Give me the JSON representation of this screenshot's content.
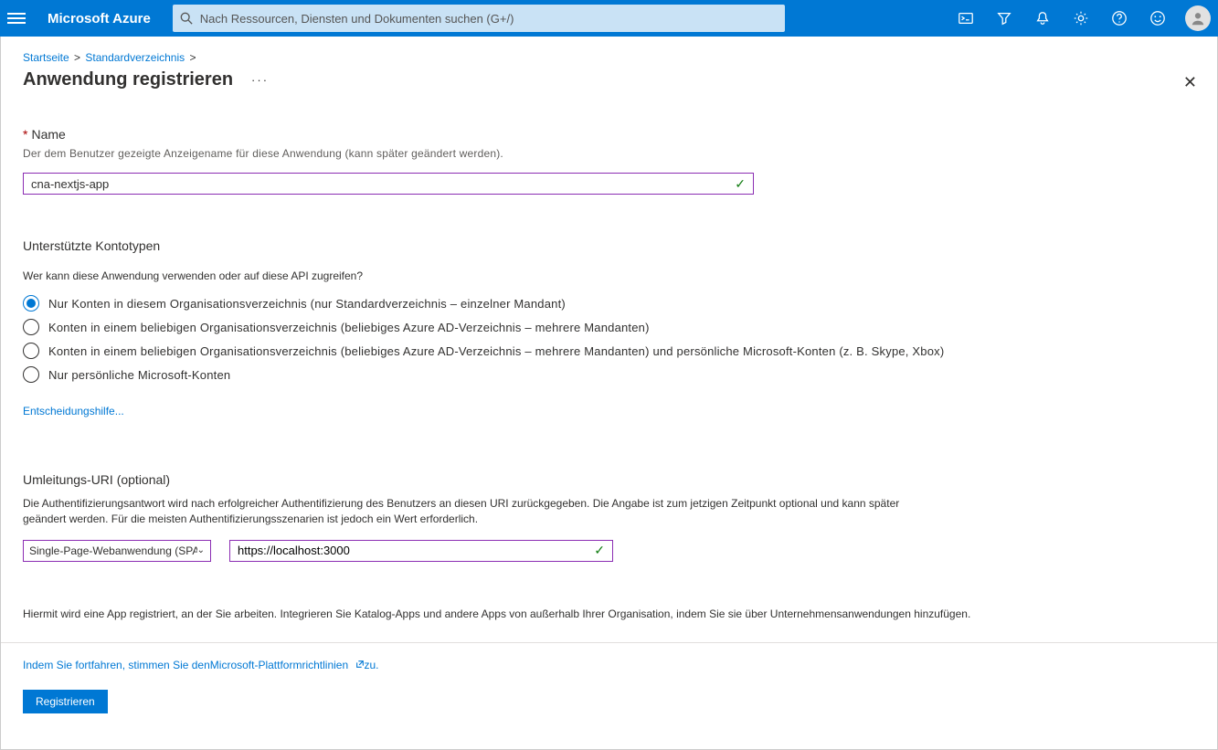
{
  "header": {
    "brand": "Microsoft Azure",
    "search_placeholder": "Nach Ressourcen, Diensten und Dokumenten suchen (G+/)"
  },
  "breadcrumb": {
    "home": "Startseite",
    "dir": "Standardverzeichnis"
  },
  "page": {
    "title": "Anwendung registrieren"
  },
  "name_section": {
    "label": "Name",
    "helper": "Der dem Benutzer gezeigte Anzeigename für diese Anwendung (kann später geändert werden).",
    "value": "cna-nextjs-app"
  },
  "account_types": {
    "heading": "Unterstützte Kontotypen",
    "question": "Wer kann diese Anwendung verwenden oder auf diese API zugreifen?",
    "options": [
      {
        "main": "Nur Konten in diesem Organisationsverzeichnis (nur Standardverzeichnis – einzelner Mandant)",
        "extra": ""
      },
      {
        "main": "Konten in einem beliebigen Organisationsverzeichnis (beliebiges Azure AD-Verzeichnis – mehrere Mandanten)",
        "extra": ""
      },
      {
        "main": "Konten in einem beliebigen Organisationsverzeichnis (beliebiges Azure AD-Verzeichnis – mehrere Mandanten) und persönliche Microsoft-Konten (z. B. Skype, Xbox)",
        "extra": ""
      },
      {
        "main": "Nur persönliche Microsoft-Konten",
        "extra": ""
      }
    ],
    "help_link": "Entscheidungshilfe..."
  },
  "redirect": {
    "heading": "Umleitungs-URI (optional)",
    "help": "Die Authentifizierungsantwort wird nach erfolgreicher Authentifizierung des Benutzers an diesen URI zurückgegeben. Die Angabe ist zum jetzigen Zeitpunkt optional und kann später geändert werden. Für die meisten Authentifizierungsszenarien ist jedoch ein Wert erforderlich.",
    "platform_value": "Single-Page-Webanwendung (SPA)",
    "uri_value": "https://localhost:3000"
  },
  "catalog_note": "Hiermit wird eine App registriert, an der Sie arbeiten. Integrieren Sie Katalog-Apps und andere Apps von außerhalb Ihrer Organisation, indem Sie sie über Unternehmensanwendungen hinzufügen.",
  "footer": {
    "consent_prefix": "Indem Sie fortfahren, stimmen Sie den ",
    "consent_link": "Microsoft-Plattformrichtlinien",
    "consent_suffix": " zu.",
    "register": "Registrieren"
  }
}
